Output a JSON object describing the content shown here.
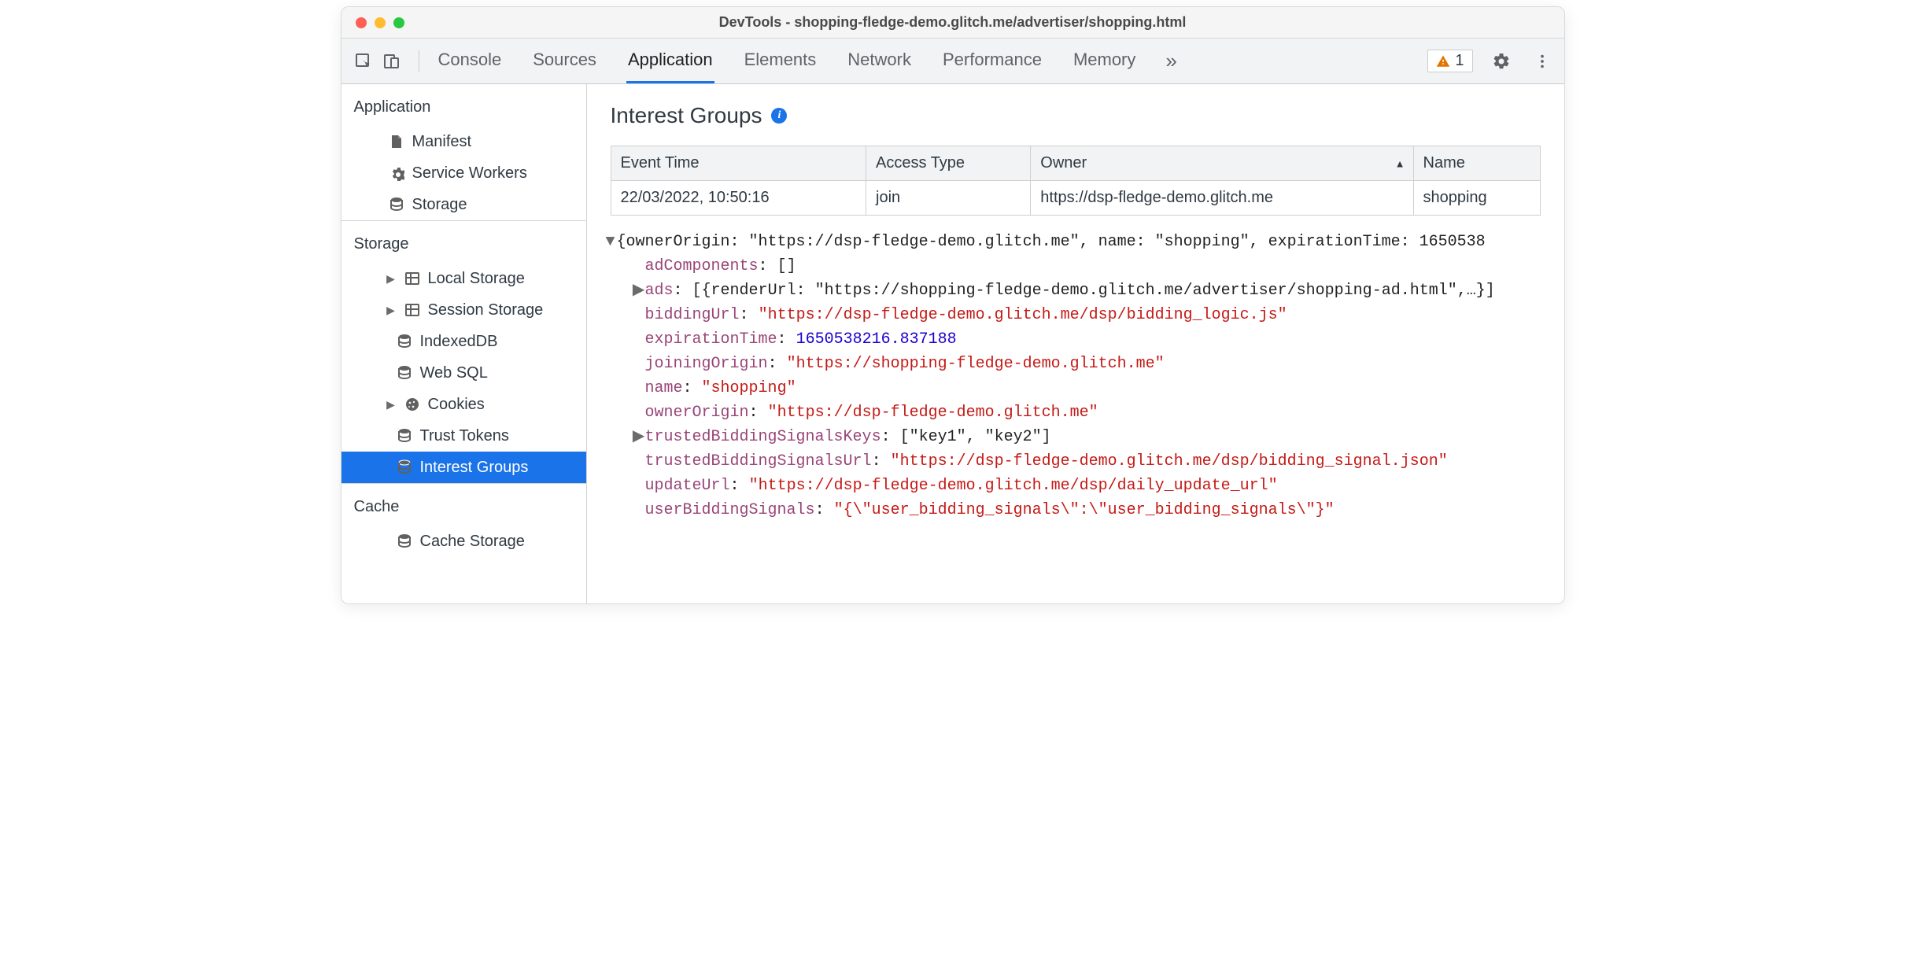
{
  "window_title": "DevTools - shopping-fledge-demo.glitch.me/advertiser/shopping.html",
  "tabs": [
    "Console",
    "Sources",
    "Application",
    "Elements",
    "Network",
    "Performance",
    "Memory"
  ],
  "active_tab": "Application",
  "issues_count": "1",
  "sidebar": {
    "application": {
      "title": "Application",
      "items": [
        {
          "id": "manifest",
          "label": "Manifest",
          "icon": "file"
        },
        {
          "id": "service-workers",
          "label": "Service Workers",
          "icon": "gear"
        },
        {
          "id": "storage-app",
          "label": "Storage",
          "icon": "db"
        }
      ]
    },
    "storage": {
      "title": "Storage",
      "items": [
        {
          "id": "local-storage",
          "label": "Local Storage",
          "icon": "grid",
          "caret": true
        },
        {
          "id": "session-storage",
          "label": "Session Storage",
          "icon": "grid",
          "caret": true
        },
        {
          "id": "indexeddb",
          "label": "IndexedDB",
          "icon": "db"
        },
        {
          "id": "websql",
          "label": "Web SQL",
          "icon": "db"
        },
        {
          "id": "cookies",
          "label": "Cookies",
          "icon": "cookie",
          "caret": true
        },
        {
          "id": "trust-tokens",
          "label": "Trust Tokens",
          "icon": "db"
        },
        {
          "id": "interest-groups",
          "label": "Interest Groups",
          "icon": "db",
          "selected": true
        }
      ]
    },
    "cache": {
      "title": "Cache",
      "items": [
        {
          "id": "cache-storage",
          "label": "Cache Storage",
          "icon": "db"
        }
      ]
    }
  },
  "panel_title": "Interest Groups",
  "table": {
    "headers": [
      "Event Time",
      "Access Type",
      "Owner",
      "Name"
    ],
    "sort_col": 2,
    "rows": [
      [
        "22/03/2022, 10:50:16",
        "join",
        "https://dsp-fledge-demo.glitch.me",
        "shopping"
      ]
    ]
  },
  "detail": {
    "summary": "{ownerOrigin: \"https://dsp-fledge-demo.glitch.me\", name: \"shopping\", expirationTime: 1650538",
    "adComponents": "[]",
    "ads": "[{renderUrl: \"https://shopping-fledge-demo.glitch.me/advertiser/shopping-ad.html\",…}]",
    "biddingUrl": "\"https://dsp-fledge-demo.glitch.me/dsp/bidding_logic.js\"",
    "expirationTime": "1650538216.837188",
    "joiningOrigin": "\"https://shopping-fledge-demo.glitch.me\"",
    "name": "\"shopping\"",
    "ownerOrigin": "\"https://dsp-fledge-demo.glitch.me\"",
    "trustedBiddingSignalsKeys": "[\"key1\", \"key2\"]",
    "trustedBiddingSignalsUrl": "\"https://dsp-fledge-demo.glitch.me/dsp/bidding_signal.json\"",
    "updateUrl": "\"https://dsp-fledge-demo.glitch.me/dsp/daily_update_url\"",
    "userBiddingSignals": "\"{\\\"user_bidding_signals\\\":\\\"user_bidding_signals\\\"}\""
  }
}
